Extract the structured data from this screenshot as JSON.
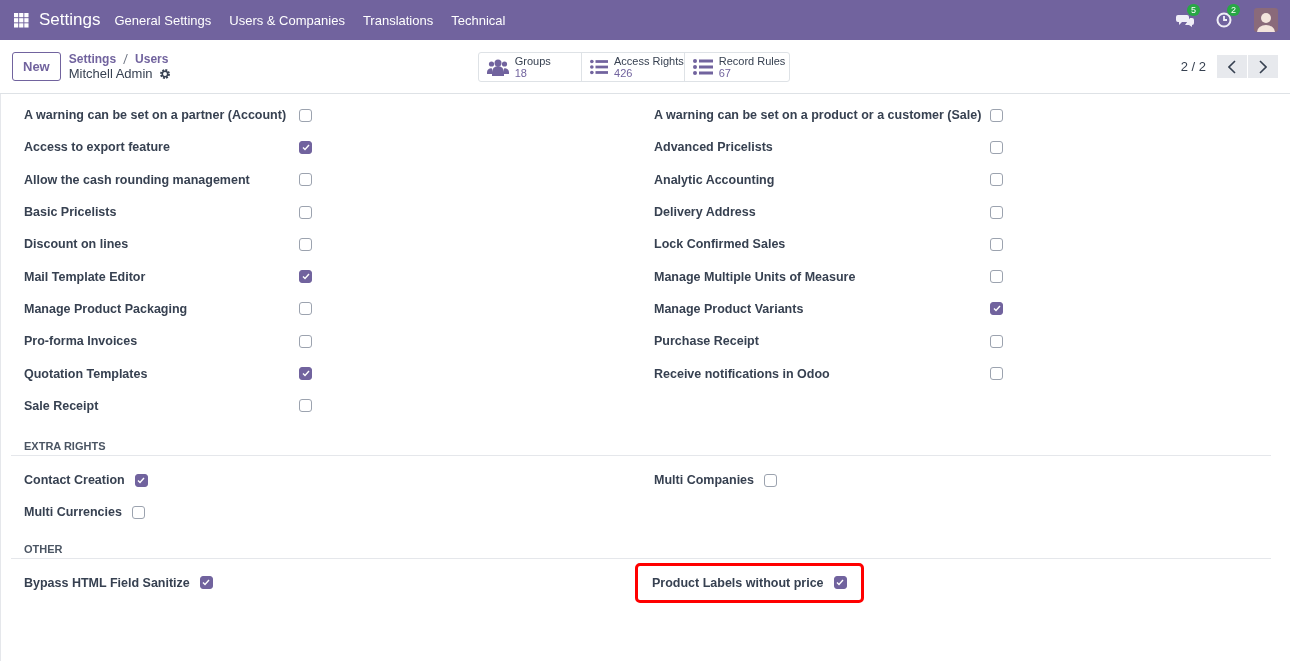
{
  "navbar": {
    "app": "Settings",
    "menus": [
      "General Settings",
      "Users & Companies",
      "Translations",
      "Technical"
    ],
    "messages_badge": "5",
    "activities_badge": "2"
  },
  "control_panel": {
    "new_button": "New",
    "breadcrumb": [
      "Settings",
      "Users"
    ],
    "record": "Mitchell Admin",
    "smart_buttons": [
      {
        "kind": "groups",
        "label": "Groups",
        "value": "18"
      },
      {
        "kind": "list",
        "label": "Access Rights",
        "value": "426"
      },
      {
        "kind": "list",
        "label": "Record Rules",
        "value": "67"
      }
    ],
    "pager": "2 / 2"
  },
  "sections": [
    {
      "kind": "grid",
      "columns": [
        [
          {
            "label": "A warning can be set on a partner (Account)",
            "checked": false
          },
          {
            "label": "Access to export feature",
            "checked": true
          },
          {
            "label": "Allow the cash rounding management",
            "checked": false
          },
          {
            "label": "Basic Pricelists",
            "checked": false
          },
          {
            "label": "Discount on lines",
            "checked": false
          },
          {
            "label": "Mail Template Editor",
            "checked": true
          },
          {
            "label": "Manage Product Packaging",
            "checked": false
          },
          {
            "label": "Pro-forma Invoices",
            "checked": false
          },
          {
            "label": "Quotation Templates",
            "checked": true
          },
          {
            "label": "Sale Receipt",
            "checked": false
          }
        ],
        [
          {
            "label": "A warning can be set on a product or a customer (Sale)",
            "checked": false
          },
          {
            "label": "Advanced Pricelists",
            "checked": false
          },
          {
            "label": "Analytic Accounting",
            "checked": false
          },
          {
            "label": "Delivery Address",
            "checked": false
          },
          {
            "label": "Lock Confirmed Sales",
            "checked": false
          },
          {
            "label": "Manage Multiple Units of Measure",
            "checked": false
          },
          {
            "label": "Manage Product Variants",
            "checked": true
          },
          {
            "label": "Purchase Receipt",
            "checked": false
          },
          {
            "label": "Receive notifications in Odoo",
            "checked": false
          }
        ]
      ]
    },
    {
      "kind": "inline",
      "title": "EXTRA RIGHTS",
      "columns": [
        [
          {
            "label": "Contact Creation",
            "checked": true
          },
          {
            "label": "Multi Currencies",
            "checked": false
          }
        ],
        [
          {
            "label": "Multi Companies",
            "checked": false
          }
        ]
      ]
    },
    {
      "kind": "inline",
      "title": "OTHER",
      "columns": [
        [
          {
            "label": "Bypass HTML Field Sanitize",
            "checked": true,
            "highlighted": false
          }
        ],
        [
          {
            "label": "Product Labels without price",
            "checked": true,
            "highlighted": true
          }
        ]
      ]
    }
  ]
}
